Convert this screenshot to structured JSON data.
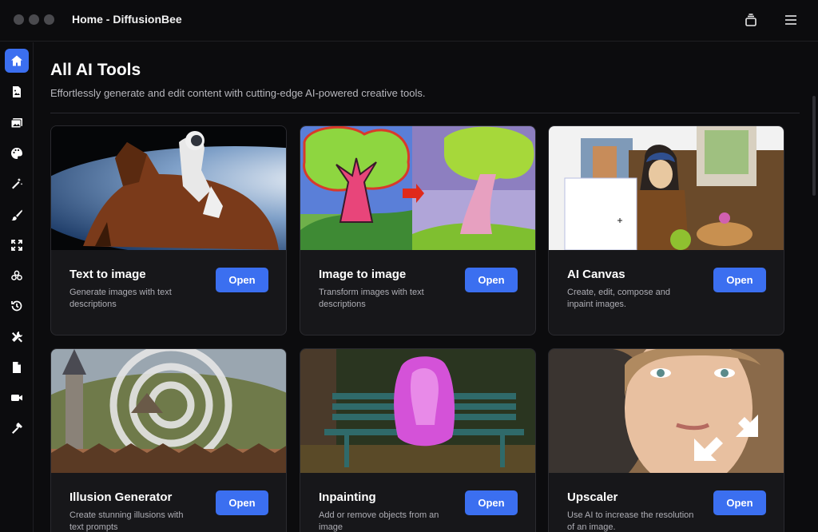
{
  "window": {
    "title": "Home - DiffusionBee"
  },
  "sidebar": {
    "items": [
      {
        "icon": "home-icon",
        "active": true
      },
      {
        "icon": "document-image-icon",
        "active": false
      },
      {
        "icon": "images-icon",
        "active": false
      },
      {
        "icon": "palette-icon",
        "active": false
      },
      {
        "icon": "magic-wand-icon",
        "active": false
      },
      {
        "icon": "brush-icon",
        "active": false
      },
      {
        "icon": "expand-arrows-icon",
        "active": false
      },
      {
        "icon": "models-icon",
        "active": false
      },
      {
        "icon": "history-icon",
        "active": false
      },
      {
        "icon": "tools-icon",
        "active": false
      },
      {
        "icon": "file-icon",
        "active": false
      },
      {
        "icon": "video-icon",
        "active": false
      },
      {
        "icon": "hammer-icon",
        "active": false
      }
    ]
  },
  "page": {
    "title": "All AI Tools",
    "subtitle": "Effortlessly generate and edit content with cutting-edge AI-powered creative tools."
  },
  "cards": [
    {
      "title": "Text to image",
      "description": "Generate images with text descriptions",
      "button": "Open"
    },
    {
      "title": "Image to image",
      "description": "Transform images with text descriptions",
      "button": "Open"
    },
    {
      "title": "AI Canvas",
      "description": "Create, edit, compose and inpaint images.",
      "button": "Open"
    },
    {
      "title": "Illusion Generator",
      "description": "Create stunning illusions with text prompts",
      "button": "Open"
    },
    {
      "title": "Inpainting",
      "description": "Add or remove objects from an image",
      "button": "Open"
    },
    {
      "title": "Upscaler",
      "description": "Use AI to increase the resolution of an image.",
      "button": "Open"
    }
  ],
  "colors": {
    "accent": "#3b6ff0",
    "background": "#0c0c0e",
    "card": "#17171a"
  }
}
